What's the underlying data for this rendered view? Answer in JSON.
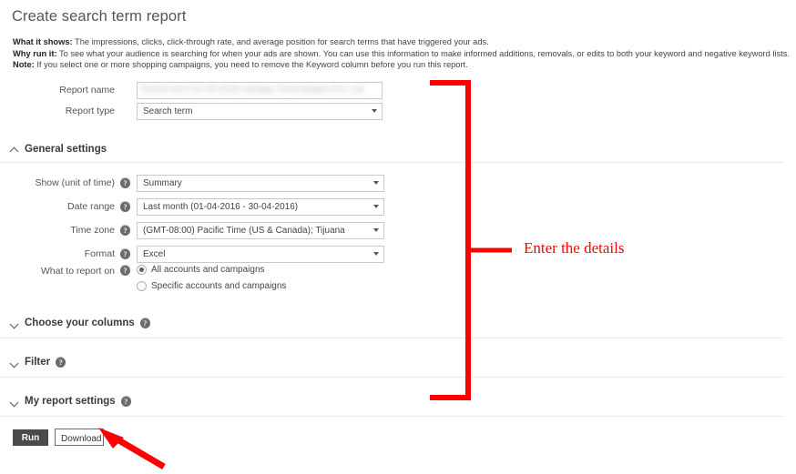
{
  "page": {
    "title": "Create search term report"
  },
  "description": {
    "lines": [
      {
        "label": "What it shows:",
        "text": " The impressions, clicks, click-through rate, and average position for search terms that have triggered your ads."
      },
      {
        "label": "Why run it:",
        "text": " To see what your audience is searching for when your ads are shown. You can use this information to make informed additions, removals, or edits to both your keyword and negative keyword lists."
      },
      {
        "label": "Note:",
        "text": " If you select one or more shopping campaigns, you need to remove the Keyword column before you run this report."
      }
    ]
  },
  "top_form": {
    "report_name": {
      "label": "Report name",
      "value": "Search term 01-04-2016 manage Technologies Pvt. Ltd",
      "redacted": true
    },
    "report_type": {
      "label": "Report type",
      "value": "Search term"
    }
  },
  "general_settings": {
    "title": "General settings",
    "expanded": true,
    "fields": {
      "show_unit_of_time": {
        "label": "Show (unit of time)",
        "value": "Summary"
      },
      "date_range": {
        "label": "Date range",
        "value": "Last month (01-04-2016 - 30-04-2016)"
      },
      "time_zone": {
        "label": "Time zone",
        "value": "(GMT-08:00) Pacific Time (US & Canada); Tijuana"
      },
      "format": {
        "label": "Format",
        "value": "Excel"
      },
      "what_to_report_on": {
        "label": "What to report on",
        "options": [
          {
            "label": "All accounts and campaigns",
            "selected": true
          },
          {
            "label": "Specific accounts and campaigns",
            "selected": false
          }
        ]
      }
    }
  },
  "sections": [
    {
      "title": "Choose your columns",
      "expanded": false
    },
    {
      "title": "Filter",
      "expanded": false
    },
    {
      "title": "My report settings",
      "expanded": false
    }
  ],
  "actions": {
    "run_label": "Run",
    "download_label": "Download"
  },
  "annotations": {
    "bracket_note": "Enter the details",
    "color": "#ff0000"
  },
  "icons": {
    "help": "?"
  }
}
